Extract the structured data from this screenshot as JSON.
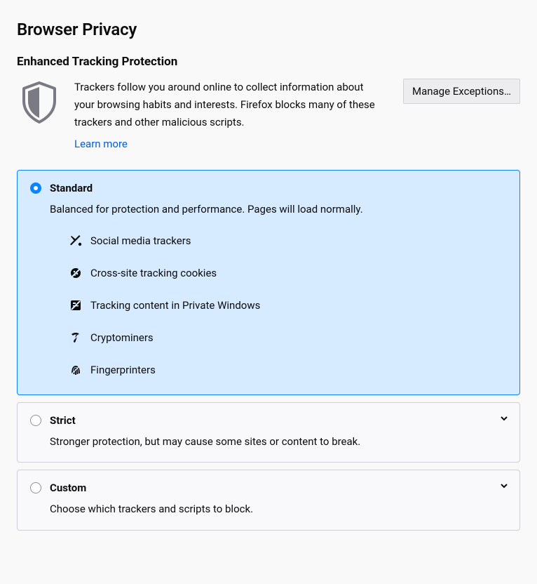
{
  "page_title": "Browser Privacy",
  "section_title": "Enhanced Tracking Protection",
  "description": "Trackers follow you around online to collect information about your browsing habits and interests. Firefox blocks many of these trackers and other malicious scripts.",
  "learn_more": "Learn more",
  "manage_exceptions": "Manage Exceptions…",
  "options": {
    "standard": {
      "label": "Standard",
      "desc": "Balanced for protection and performance. Pages will load normally.",
      "trackers": [
        "Social media trackers",
        "Cross-site tracking cookies",
        "Tracking content in Private Windows",
        "Cryptominers",
        "Fingerprinters"
      ]
    },
    "strict": {
      "label": "Strict",
      "desc": "Stronger protection, but may cause some sites or content to break."
    },
    "custom": {
      "label": "Custom",
      "desc": "Choose which trackers and scripts to block."
    }
  }
}
